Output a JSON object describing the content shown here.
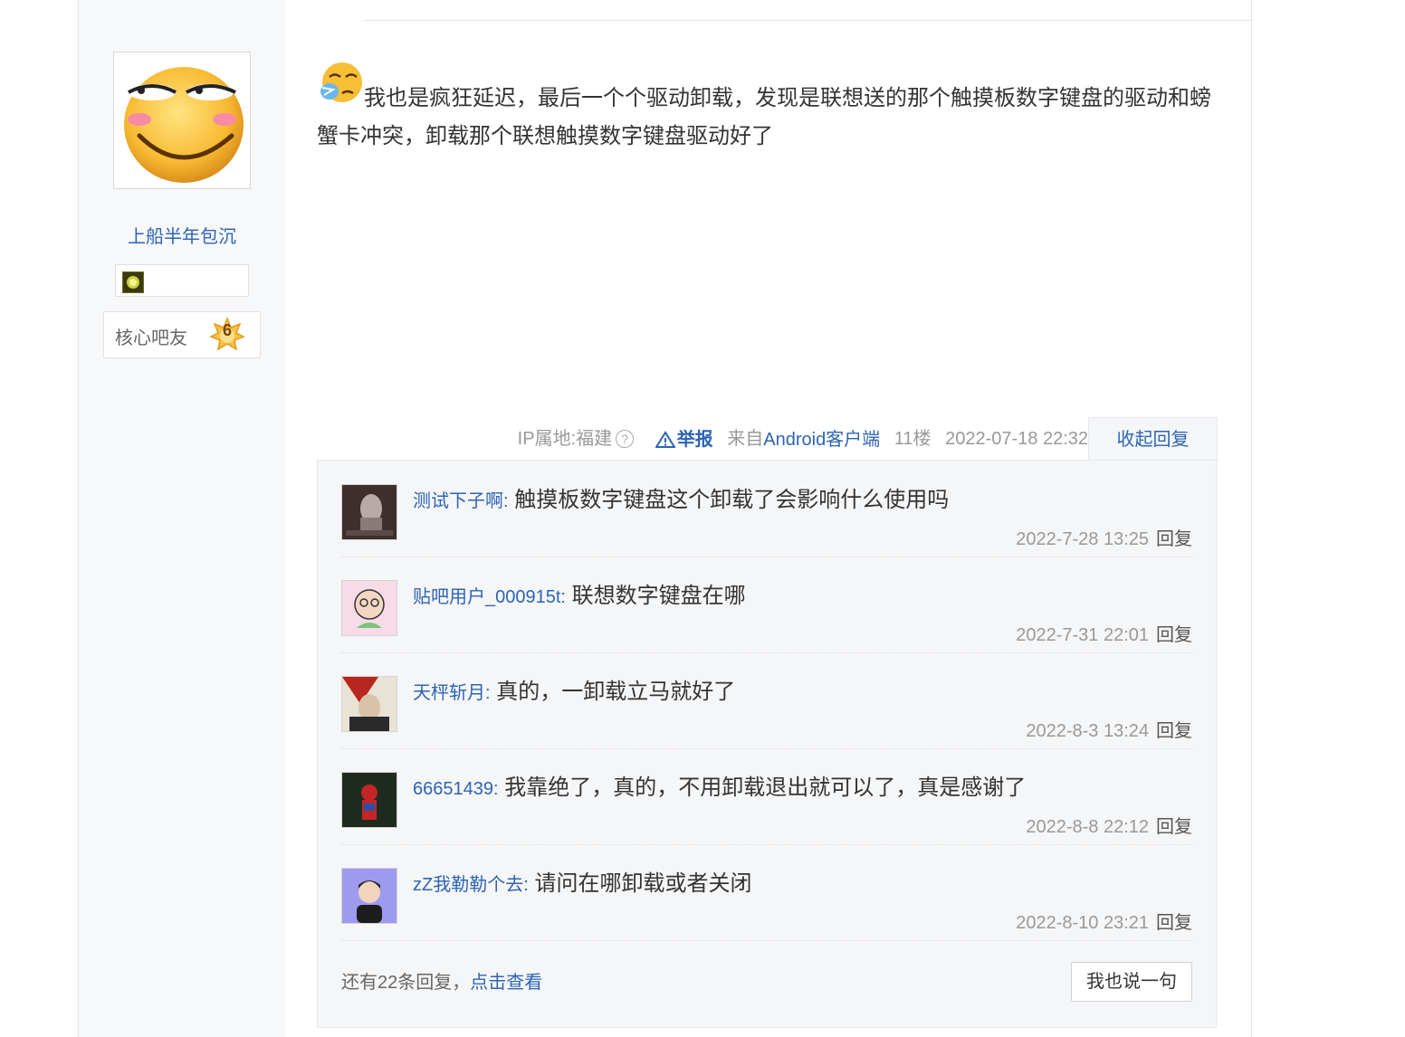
{
  "author": {
    "name": "上船半年包沉",
    "level_name": "核心吧友",
    "level_number": "6"
  },
  "post": {
    "text": "我也是疯狂延迟，最后一个个驱动卸载，发现是联想送的那个触摸板数字键盘的驱动和螃蟹卡冲突，卸载那个联想触摸数字键盘驱动好了",
    "ip_location": "IP属地:福建",
    "help_icon": "?",
    "report_label": "举报",
    "client": "来自Android客户端",
    "floor": "11楼",
    "datetime": "2022-07-18 22:32",
    "collapse_label": "收起回复"
  },
  "replies": [
    {
      "user": "测试下子啊",
      "text": "触摸板数字键盘这个卸载了会影响什么使用吗",
      "time": "2022-7-28 13:25",
      "reply_label": "回复"
    },
    {
      "user": "贴吧用户_000915t",
      "text": "联想数字键盘在哪",
      "time": "2022-7-31 22:01",
      "reply_label": "回复"
    },
    {
      "user": "天枰斩月",
      "text": "真的，一卸载立马就好了",
      "time": "2022-8-3 13:24",
      "reply_label": "回复"
    },
    {
      "user": "66651439",
      "text": "我靠绝了，真的，不用卸载退出就可以了，真是感谢了",
      "time": "2022-8-8 22:12",
      "reply_label": "回复"
    },
    {
      "user": "zZ我勒勒个去",
      "text": "请问在哪卸载或者关闭",
      "time": "2022-8-10 23:21",
      "reply_label": "回复"
    }
  ],
  "more": {
    "prefix": "还有22条回复，",
    "link": "点击查看",
    "say_button": "我也说一句"
  },
  "colors": {
    "link_blue": "#2d64b3",
    "reply_bg": "#f5f6f8",
    "author_col_bg": "#f7f8fa"
  }
}
